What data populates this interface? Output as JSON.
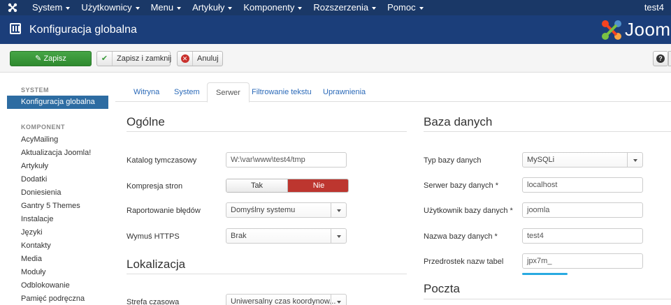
{
  "topbar": {
    "menu": [
      "System",
      "Użytkownicy",
      "Menu",
      "Artykuły",
      "Komponenty",
      "Rozszerzenia",
      "Pomoc"
    ],
    "user": "test4"
  },
  "header": {
    "title": "Konfiguracja globalna",
    "brand": "Joom"
  },
  "toolbar": {
    "save": "Zapisz",
    "save_close": "Zapisz i zamknij",
    "cancel": "Anuluj"
  },
  "sidebar": {
    "system_heading": "SYSTEM",
    "active_item": "Konfiguracja globalna",
    "component_heading": "KOMPONENT",
    "items": [
      "AcyMailing",
      "Aktualizacja Joomla!",
      "Artykuły",
      "Dodatki",
      "Doniesienia",
      "Gantry 5 Themes",
      "Instalacje",
      "Języki",
      "Kontakty",
      "Media",
      "Moduły",
      "Odblokowanie",
      "Pamięć podręczna"
    ]
  },
  "tabs": [
    "Witryna",
    "System",
    "Serwer",
    "Filtrowanie tekstu",
    "Uprawnienia"
  ],
  "active_tab": "Serwer",
  "general": {
    "title": "Ogólne",
    "tmp_label": "Katalog tymczasowy",
    "tmp_value": "W:\\var\\www\\test4/tmp",
    "gzip_label": "Kompresja stron",
    "gzip_yes": "Tak",
    "gzip_no": "Nie",
    "error_label": "Raportowanie błędów",
    "error_value": "Domyślny systemu",
    "https_label": "Wymuś HTTPS",
    "https_value": "Brak"
  },
  "locale": {
    "title": "Lokalizacja",
    "tz_label": "Strefa czasowa",
    "tz_value": "Uniwersalny czas koordynow..."
  },
  "database": {
    "title": "Baza danych",
    "type_label": "Typ bazy danych",
    "type_value": "MySQLi",
    "host_label": "Serwer bazy danych *",
    "host_value": "localhost",
    "user_label": "Użytkownik bazy danych *",
    "user_value": "joomla",
    "name_label": "Nazwa bazy danych *",
    "name_value": "test4",
    "prefix_label": "Przedrostek nazw tabel",
    "prefix_value": "jpx7m_"
  },
  "mail": {
    "title": "Poczta"
  },
  "colors": {
    "topbar": "#1a3867",
    "header": "#1b3e7a",
    "save": "#46a546",
    "active": "#2d6ca2",
    "toggle_on": "#bd362f",
    "highlight": "#29aae1"
  }
}
